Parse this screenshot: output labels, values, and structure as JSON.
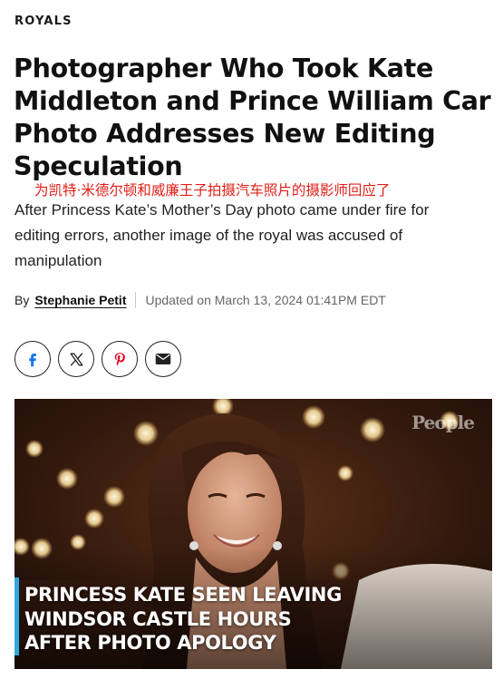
{
  "article": {
    "category": "ROYALS",
    "headline": "Photographer Who Took Kate Middleton and Prince William Car Photo Addresses New Editing Speculation",
    "translation": "为凯特·米德尔顿和威廉王子拍摄汽车照片的摄影师回应了",
    "dek": "After Princess Kate’s Mother’s Day photo came under fire for editing errors, another image of the royal was accused of manipulation",
    "byline": {
      "by": "By",
      "author": "Stephanie Petit",
      "updated": "Updated on March 13, 2024 01:41PM EDT"
    }
  },
  "share": {
    "buttons": [
      {
        "name": "facebook",
        "icon": "facebook-icon"
      },
      {
        "name": "x",
        "icon": "x-icon"
      },
      {
        "name": "pinterest",
        "icon": "pinterest-icon"
      },
      {
        "name": "email",
        "icon": "envelope-icon"
      }
    ],
    "colors": {
      "facebook": "#1877f2",
      "x": "#111111",
      "pinterest": "#e60023",
      "email": "#222222"
    }
  },
  "hero": {
    "watermark": "People",
    "caption_lines": [
      "PRINCESS KATE SEEN LEAVING",
      "WINDSOR CASTLE HOURS",
      "AFTER PHOTO APOLOGY"
    ],
    "accent_color": "#2fa8e0"
  }
}
